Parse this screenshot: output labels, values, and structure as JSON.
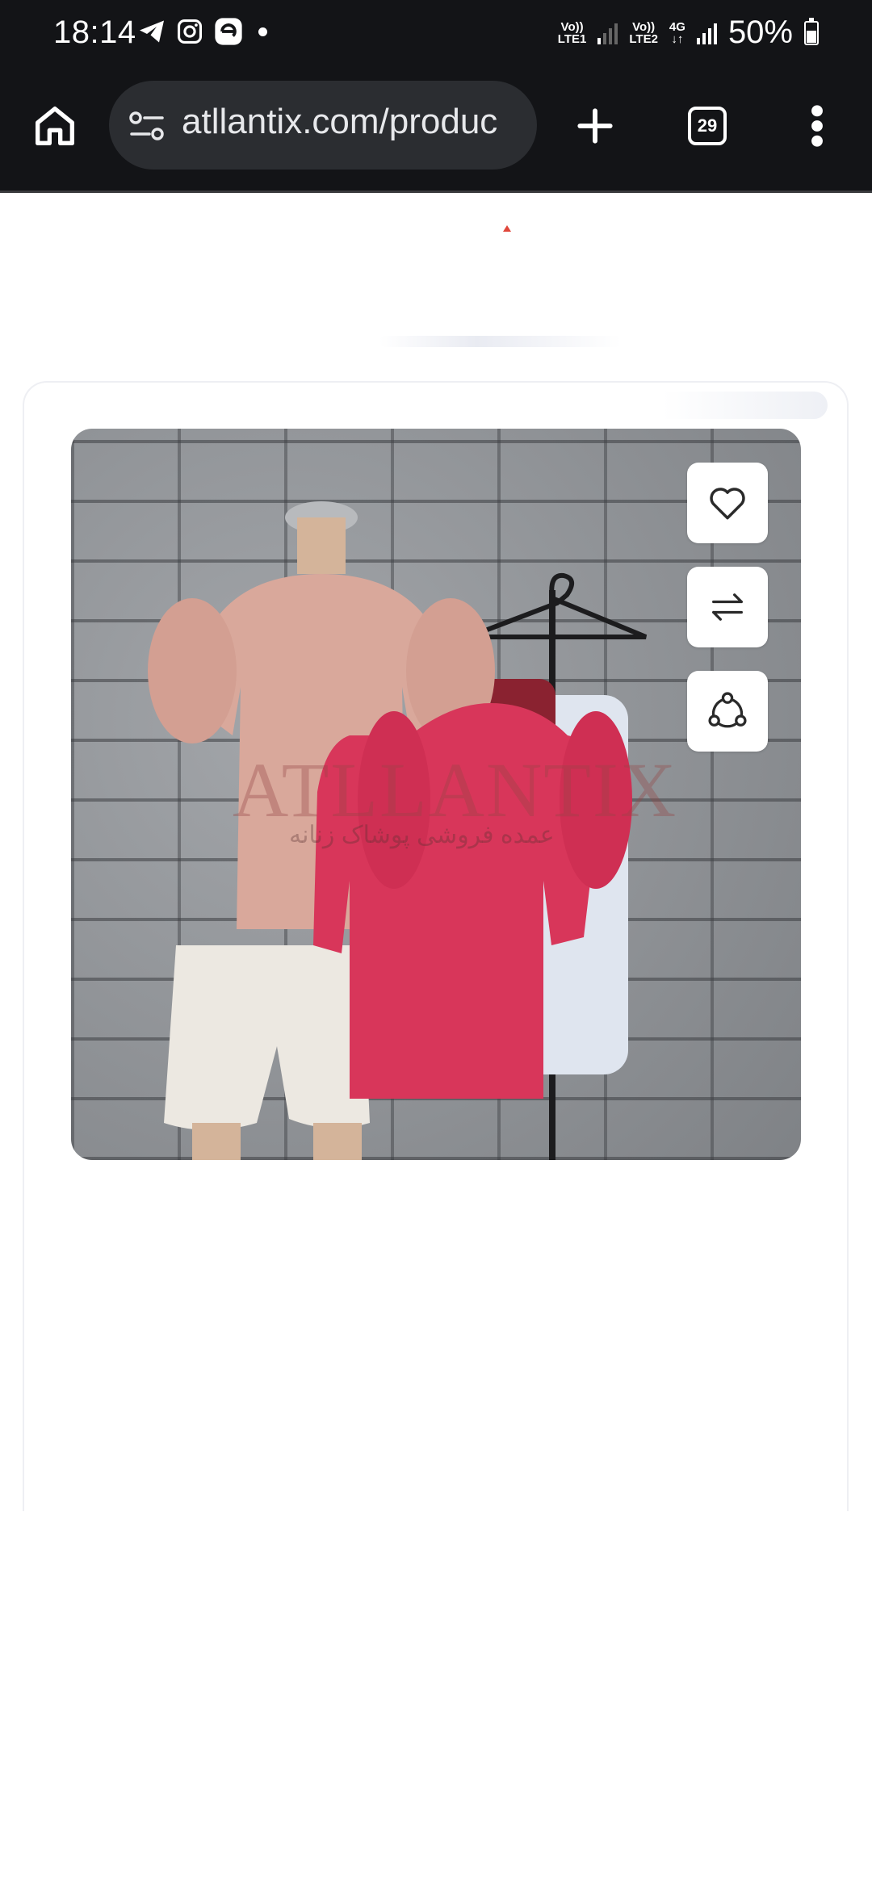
{
  "status_bar": {
    "time": "18:14",
    "sim1": [
      "Vo))",
      "LTE1"
    ],
    "sim2": [
      "Vo))",
      "LTE2"
    ],
    "network_type": "4G",
    "battery": "50%"
  },
  "browser": {
    "url": "atllantix.com/produc",
    "tab_count": "29"
  },
  "product": {
    "watermark": "ATLLANTIX",
    "watermark_sub": "عمده فروشی پوشاک زنانه",
    "actions": [
      "wishlist",
      "compare",
      "share"
    ]
  }
}
